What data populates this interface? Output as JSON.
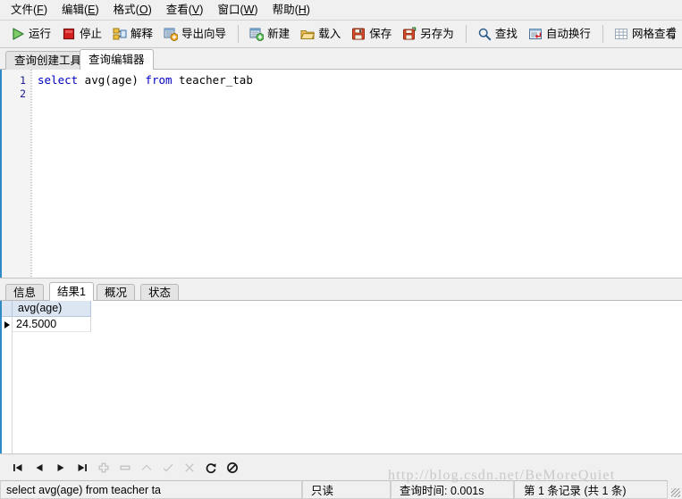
{
  "menubar": {
    "items": [
      {
        "name": "file",
        "text": "文件",
        "accel": "F"
      },
      {
        "name": "edit",
        "text": "编辑",
        "accel": "E"
      },
      {
        "name": "format",
        "text": "格式",
        "accel": "O"
      },
      {
        "name": "view",
        "text": "查看",
        "accel": "V"
      },
      {
        "name": "window",
        "text": "窗口",
        "accel": "W"
      },
      {
        "name": "help",
        "text": "帮助",
        "accel": "H"
      }
    ]
  },
  "toolbar": {
    "run_label": "运行",
    "stop_label": "停止",
    "explain_label": "解释",
    "export_wizard_label": "导出向导",
    "new_label": "新建",
    "load_label": "载入",
    "save_label": "保存",
    "save_as_label": "另存为",
    "find_label": "查找",
    "wrap_label": "自动换行",
    "grid_view_label": "网格查看",
    "overflow_more": "»",
    "overflow_down": "▾"
  },
  "tabs": {
    "items": [
      {
        "name": "query-builder",
        "label": "查询创建工具",
        "active": false
      },
      {
        "name": "query-editor",
        "label": "查询编辑器",
        "active": true
      }
    ]
  },
  "editor": {
    "line_numbers": [
      "1",
      "2"
    ],
    "sql_tokens": [
      {
        "t": "select",
        "kw": true
      },
      {
        "t": " avg(age) ",
        "kw": false
      },
      {
        "t": "from",
        "kw": true
      },
      {
        "t": " teacher_tab",
        "kw": false
      }
    ]
  },
  "result_tabs": {
    "items": [
      {
        "name": "info",
        "label": "信息",
        "active": false
      },
      {
        "name": "result1",
        "label": "结果1",
        "active": true
      },
      {
        "name": "profile",
        "label": "概况",
        "active": false
      },
      {
        "name": "status",
        "label": "状态",
        "active": false
      }
    ]
  },
  "grid": {
    "columns": [
      "avg(age)"
    ],
    "rows": [
      {
        "selected": true,
        "cells": [
          "24.5000"
        ]
      }
    ]
  },
  "nav_toolbar": {
    "buttons": [
      {
        "name": "first-record-button",
        "icon": "first-icon",
        "enabled": true
      },
      {
        "name": "prev-record-button",
        "icon": "prev-icon",
        "enabled": true
      },
      {
        "name": "next-record-button",
        "icon": "next-icon",
        "enabled": true
      },
      {
        "name": "last-record-button",
        "icon": "last-icon",
        "enabled": true
      },
      {
        "name": "insert-record-button",
        "icon": "plus-icon",
        "enabled": false
      },
      {
        "name": "delete-record-button",
        "icon": "minus-icon",
        "enabled": false
      },
      {
        "name": "edit-record-button",
        "icon": "caret-up-icon",
        "enabled": false
      },
      {
        "name": "post-edit-button",
        "icon": "check-icon",
        "enabled": false
      },
      {
        "name": "cancel-edit-button",
        "icon": "cancel-x-icon",
        "enabled": false
      },
      {
        "name": "refresh-button",
        "icon": "refresh-icon",
        "enabled": true
      },
      {
        "name": "stop-button",
        "icon": "no-entry-icon",
        "enabled": true
      }
    ]
  },
  "statusbar": {
    "sql_text": "select avg(age) from teacher ta",
    "readonly_text": "只读",
    "query_time_text": "查询时间: 0.001s",
    "record_text": "第 1 条记录 (共 1 条)"
  },
  "watermark": {
    "text": "http://blog.csdn.net/BeMoreQuiet"
  },
  "colors": {
    "accent_blue": "#2e8bc6",
    "keyword_blue": "#0000c0",
    "header_blue": "#dce6f2",
    "chrome_gray": "#f0f0f0",
    "run_green": "#3ba93b",
    "stop_red": "#d41f1f"
  }
}
